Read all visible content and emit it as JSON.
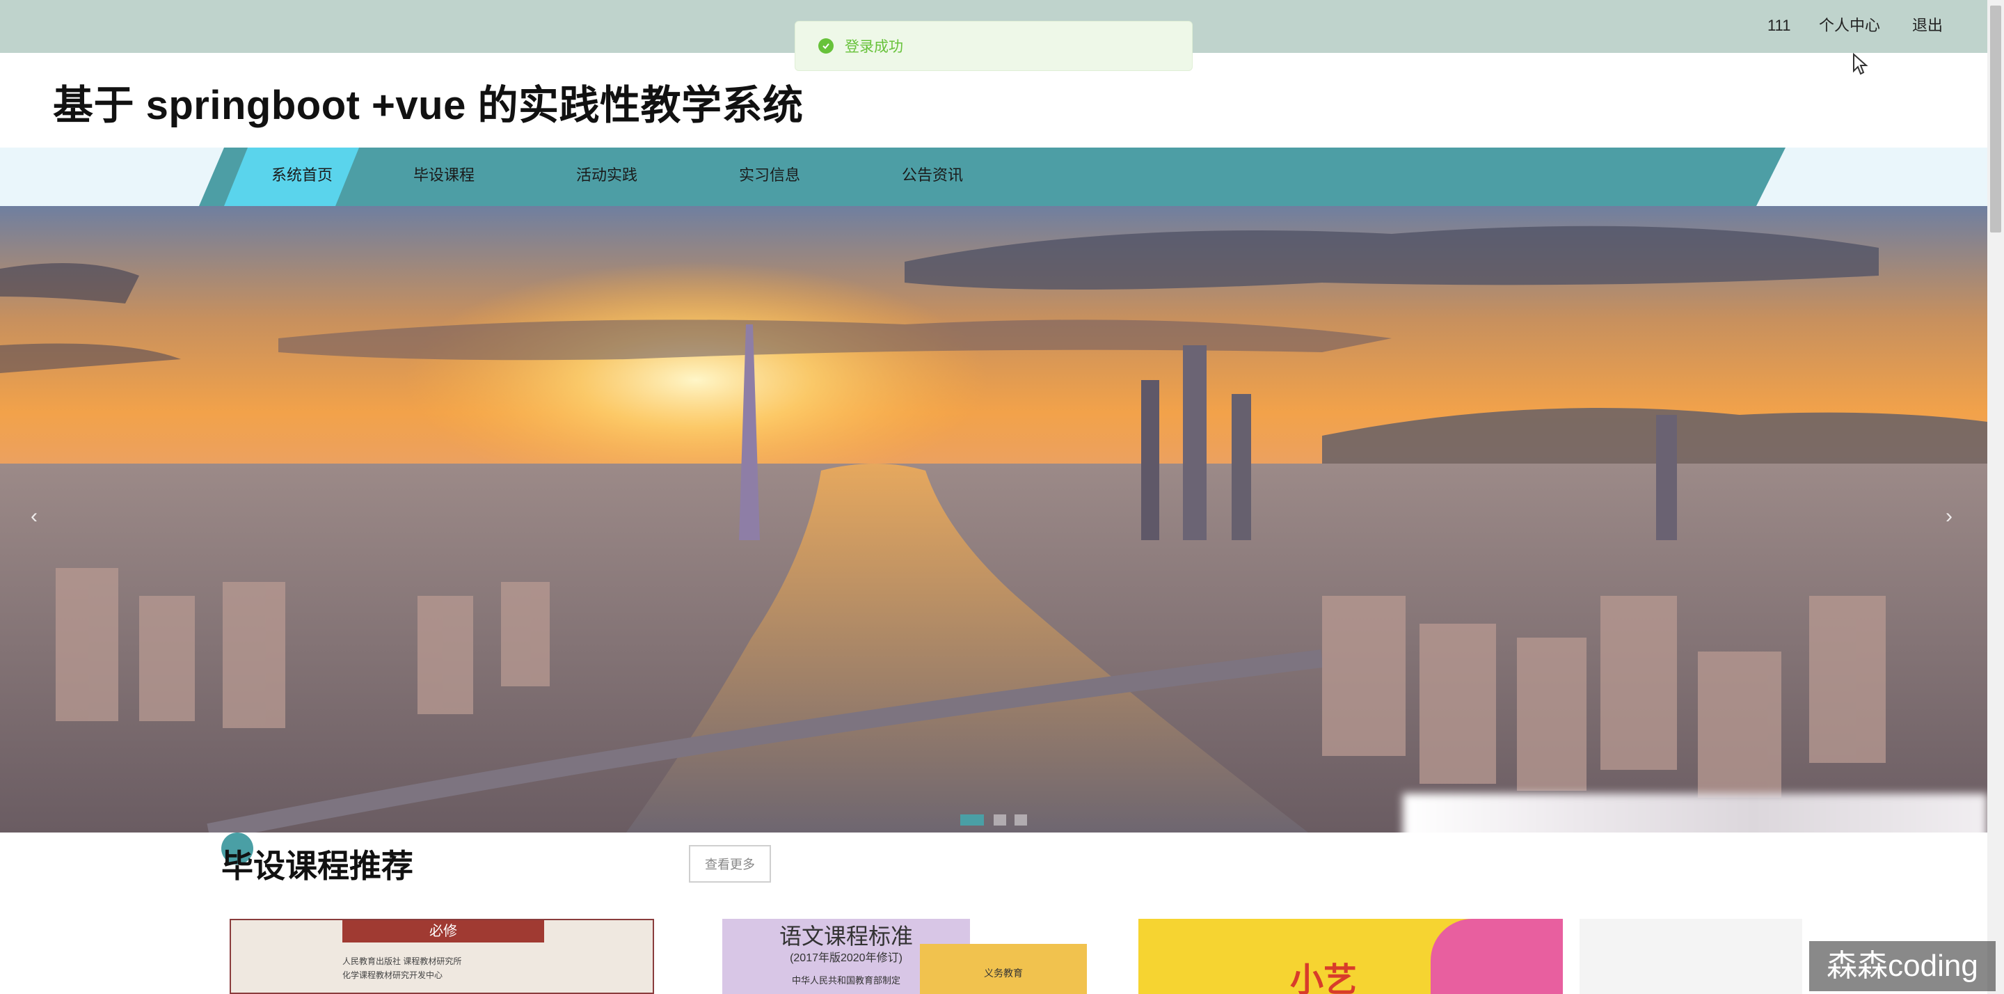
{
  "topbar": {
    "username": "111",
    "profile_label": "个人中心",
    "logout_label": "退出"
  },
  "toast": {
    "message": "登录成功",
    "color": "#67c23a"
  },
  "site": {
    "title": "基于 springboot +vue 的实践性教学系统"
  },
  "nav": {
    "items": [
      {
        "label": "系统首页",
        "active": true
      },
      {
        "label": "毕设课程",
        "active": false
      },
      {
        "label": "活动实践",
        "active": false
      },
      {
        "label": "实习信息",
        "active": false
      },
      {
        "label": "公告资讯",
        "active": false
      }
    ],
    "accent_color": "#4d9ea5",
    "active_color": "#5ad4ec"
  },
  "banner": {
    "prev_arrow": "‹",
    "next_arrow": "›",
    "slide_count": 3,
    "active_slide": 1
  },
  "section": {
    "title": "毕设课程推荐",
    "more_label": "查看更多"
  },
  "cards": [
    {
      "texts": [
        "必修",
        "人民教育出版社   课程教材研究所",
        "化学课程教材研究开发中心"
      ]
    },
    {
      "texts": [
        "语文课程标准",
        "(2017年版2020年修订)",
        "中华人民共和国教育部制定",
        "义务教育"
      ]
    },
    {
      "texts": [
        "小艺"
      ]
    }
  ],
  "watermark": "森森coding"
}
